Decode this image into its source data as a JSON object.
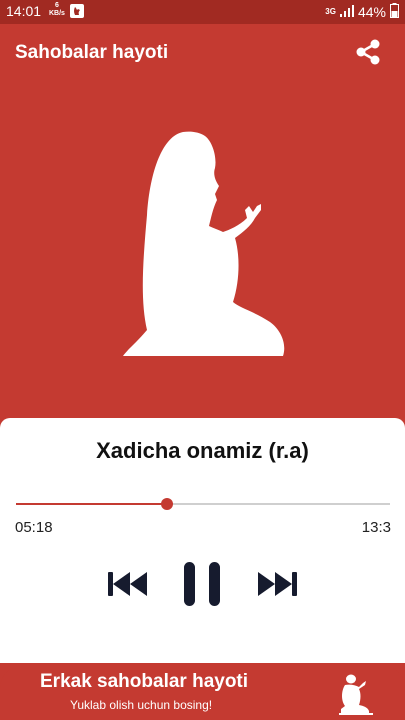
{
  "status_bar": {
    "time": "14:01",
    "speed_value": "6",
    "speed_unit": "KB/s",
    "network": "3G",
    "battery": "44%"
  },
  "app": {
    "title": "Sahobalar hayoti"
  },
  "player": {
    "track_title": "Xadicha onamiz (r.a)",
    "elapsed": "05:18",
    "total": "13:3",
    "progress": 0.405
  },
  "banner": {
    "title": "Erkak sahobalar hayoti",
    "subtitle": "Yuklab olish uchun bosing!"
  },
  "colors": {
    "primary": "#c43a31",
    "status_bar": "#a12a22",
    "controls": "#161b2e"
  }
}
